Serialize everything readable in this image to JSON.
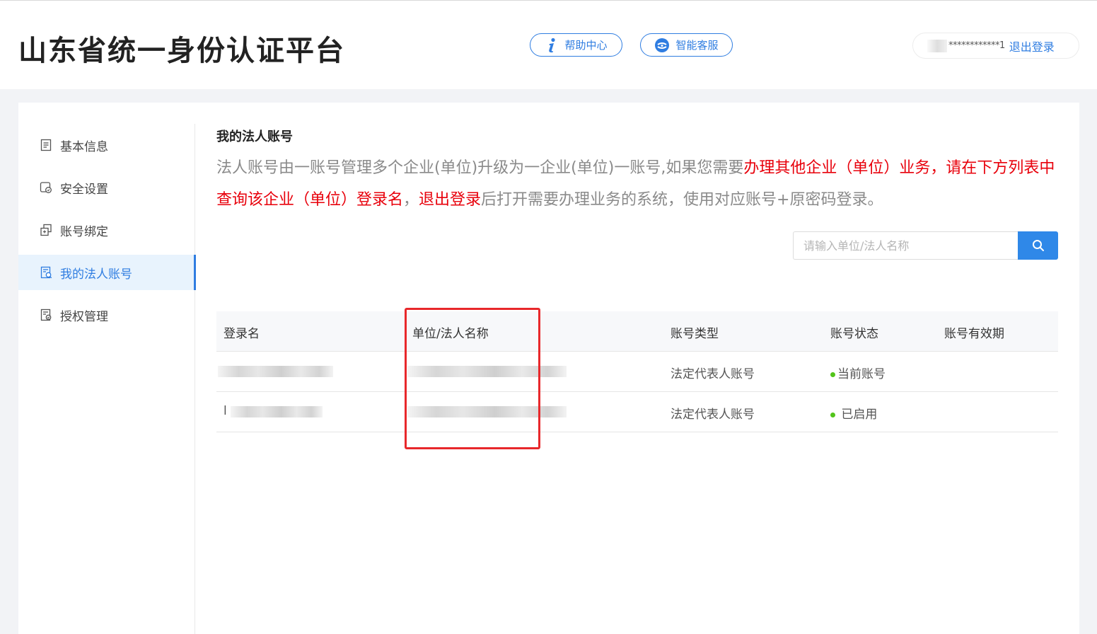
{
  "header": {
    "title": "山东省统一身份认证平台",
    "help_label": "帮助中心",
    "service_label": "智能客服",
    "username_masked": "************1",
    "logout_label": "退出登录"
  },
  "sidebar": {
    "items": [
      {
        "label": "基本信息",
        "icon": "document-icon"
      },
      {
        "label": "安全设置",
        "icon": "shield-icon"
      },
      {
        "label": "账号绑定",
        "icon": "link-icon"
      },
      {
        "label": "我的法人账号",
        "icon": "account-icon",
        "active": true
      },
      {
        "label": "授权管理",
        "icon": "authorization-icon"
      }
    ]
  },
  "content": {
    "section_title": "我的法人账号",
    "notice_part1": "法人账号由一账号管理多个企业(单位)升级为一企业(单位)一账号,如果您需要",
    "notice_red1": "办理其他企业（单位）业务，请在下方列表中查询该企业（单位）登录名",
    "notice_part2": "，",
    "notice_red2": "退出登录",
    "notice_part3": "后打开需要办理业务的系统，使用对应账号+原密码登录。",
    "search_placeholder": "请输入单位/法人名称"
  },
  "table": {
    "columns": [
      "登录名",
      "单位/法人名称",
      "账号类型",
      "账号状态",
      "账号有效期"
    ],
    "rows": [
      {
        "login_prefix": "",
        "type": "法定代表人账号",
        "status": "当前账号",
        "status_color": "#52c41a",
        "validity": ""
      },
      {
        "login_prefix": "l",
        "type": "法定代表人账号",
        "status": " 已启用",
        "status_color": "#52c41a",
        "validity": ""
      }
    ]
  },
  "colors": {
    "accent": "#2f7de1",
    "warning_text": "#e8000b",
    "highlight_border": "#e8282b",
    "status_green": "#52c41a"
  }
}
